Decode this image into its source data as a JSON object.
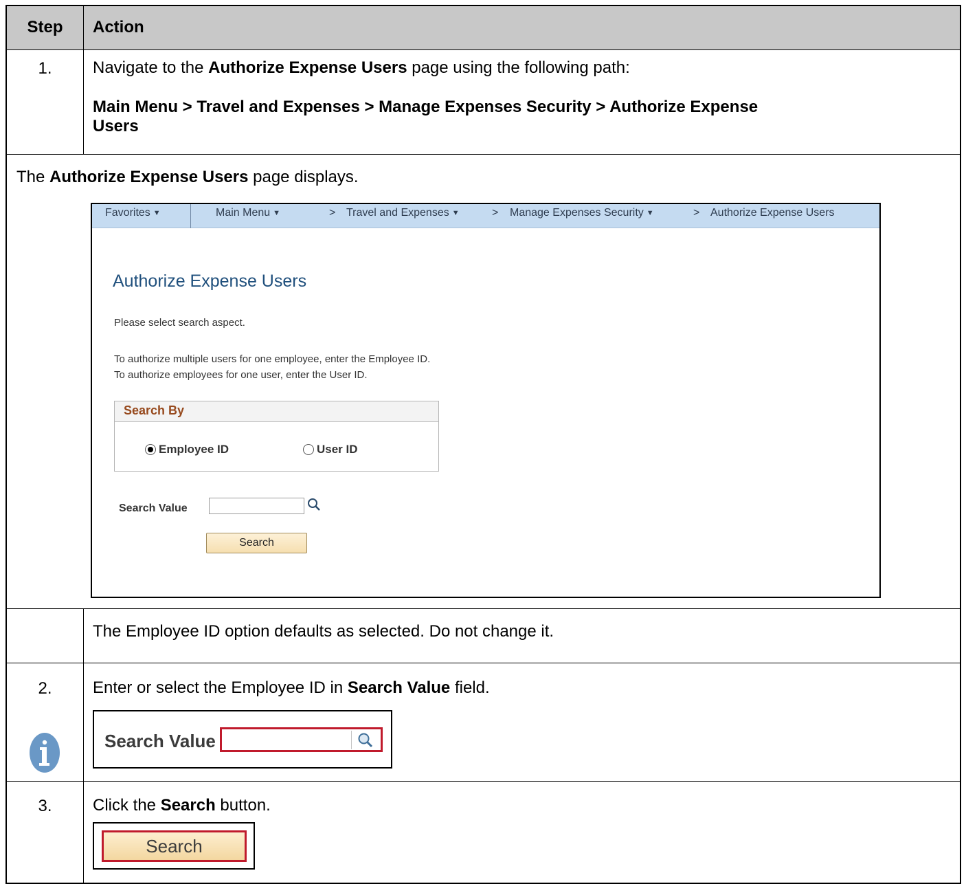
{
  "table": {
    "header": {
      "step": "Step",
      "action": "Action"
    },
    "row1": {
      "step": "1.",
      "text_pre": "Navigate to the ",
      "text_bold": "Authorize Expense Users",
      "text_post": " page using the following path:",
      "path_line1": "Main Menu > Travel and Expenses > Manage Expenses Security > Authorize Expense",
      "path_line2": "Users"
    },
    "caption": {
      "pre": "The ",
      "bold": "Authorize Expense Users",
      "post": " page displays."
    },
    "note": {
      "icon": "info-icon",
      "text": "The Employee ID option defaults as selected.  Do not change it."
    },
    "row2": {
      "step": "2.",
      "text_pre": "Enter or select the Employee ID in ",
      "text_bold": "Search Value",
      "text_post": " field."
    },
    "row3": {
      "step": "3.",
      "text_pre": "Click the ",
      "text_bold": "Search",
      "text_post": " button."
    }
  },
  "screenshot": {
    "breadcrumbs": {
      "favorites": "Favorites",
      "main_menu": "Main Menu",
      "travel": "Travel and Expenses",
      "security": "Manage Expenses Security",
      "current": "Authorize Expense Users",
      "separator": ">"
    },
    "page_title": "Authorize Expense Users",
    "instruction": "Please select search aspect.",
    "help_line1": "To authorize multiple users for one employee, enter the Employee ID.",
    "help_line2": "To authorize employees for one user, enter the User ID.",
    "search_by": {
      "title": "Search By",
      "options": [
        {
          "label": "Employee ID",
          "selected": true
        },
        {
          "label": "User ID",
          "selected": false
        }
      ]
    },
    "search_value_label": "Search Value",
    "search_value": "",
    "search_button": "Search"
  },
  "snippets": {
    "field_label": "Search Value",
    "button_label": "Search",
    "highlight_color": "#c01a2c"
  }
}
